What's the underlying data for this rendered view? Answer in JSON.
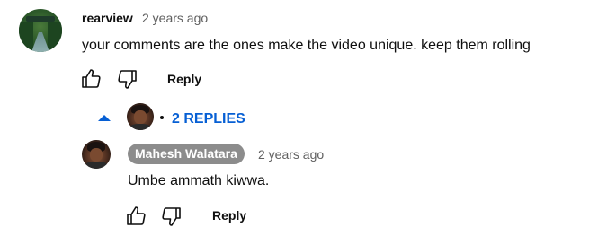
{
  "comment": {
    "author": "rearview",
    "timestamp": "2 years ago",
    "text": "your comments are the ones make the video unique. keep them rolling",
    "like_icon": "thumb-up-icon",
    "dislike_icon": "thumb-down-icon",
    "reply_label": "Reply"
  },
  "replies_toggle": {
    "label": "2 REPLIES",
    "accent": "#065fd4",
    "caret_icon": "caret-up-icon"
  },
  "reply": {
    "author": "Mahesh Walatara",
    "author_chip_color": "#8c8c8c",
    "timestamp": "2 years ago",
    "text": "Umbe ammath kiwwa.",
    "like_icon": "thumb-up-icon",
    "dislike_icon": "thumb-down-icon",
    "reply_label": "Reply"
  }
}
